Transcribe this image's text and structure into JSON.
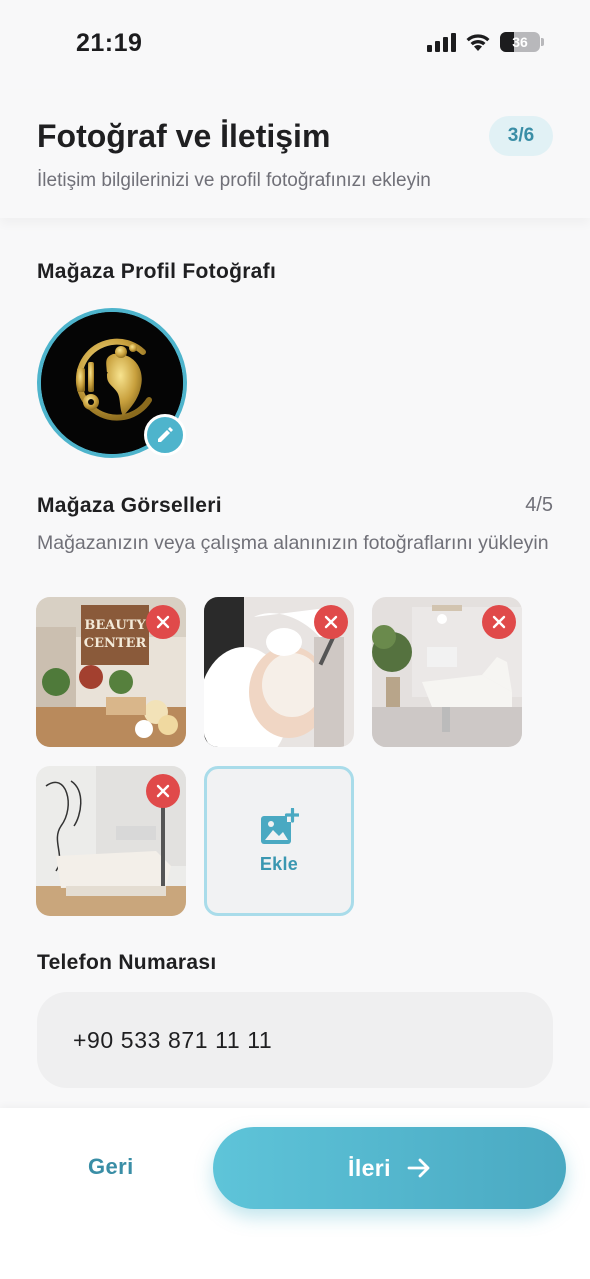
{
  "status_bar": {
    "time": "21:19",
    "battery_level": "36",
    "signal_icon": "cellular-signal-icon",
    "wifi_icon": "wifi-icon"
  },
  "header": {
    "title": "Fotoğraf ve İletişim",
    "step": "3/6",
    "subtitle": "İletişim bilgilerinizi ve profil fotoğrafınızı ekleyin"
  },
  "profile_photo": {
    "section_title": "Mağaza Profil Fotoğrafı",
    "edit_icon": "pencil-icon"
  },
  "gallery": {
    "section_title": "Mağaza Görselleri",
    "count": "4/5",
    "description": "Mağazanızın veya çalışma alanınızın fotoğraflarını yükleyin",
    "images": [
      {
        "name": "beauty-center-storefront-photo",
        "sign_text": [
          "BEAUTY",
          "CENTER"
        ]
      },
      {
        "name": "facial-treatment-photo"
      },
      {
        "name": "treatment-room-chair-photo"
      },
      {
        "name": "massage-room-photo"
      }
    ],
    "remove_icon": "close-icon",
    "add_label": "Ekle",
    "add_icon": "add-photo-icon"
  },
  "phone": {
    "section_title": "Telefon Numarası",
    "value": "+90 533 871 11 11"
  },
  "footer": {
    "back_label": "Geri",
    "next_label": "İleri",
    "next_icon": "arrow-right-icon"
  },
  "colors": {
    "accent": "#4eb4cc",
    "remove": "#e04a4a",
    "background": "#f8f8f9"
  }
}
